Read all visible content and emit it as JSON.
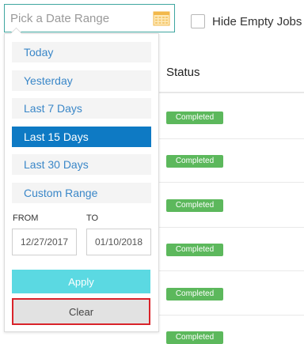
{
  "date_input": {
    "placeholder": "Pick a Date Range",
    "icon": "calendar-icon"
  },
  "hide_empty": {
    "label": "Hide Empty Jobs",
    "checked": false
  },
  "table": {
    "status_header": "Status",
    "rows": [
      {
        "status": "Completed"
      },
      {
        "status": "Completed"
      },
      {
        "status": "Completed"
      },
      {
        "status": "Completed"
      },
      {
        "status": "Completed"
      },
      {
        "status": "Completed"
      }
    ]
  },
  "ranges": [
    {
      "label": "Today",
      "active": false
    },
    {
      "label": "Yesterday",
      "active": false
    },
    {
      "label": "Last 7 Days",
      "active": false
    },
    {
      "label": "Last 15 Days",
      "active": true
    },
    {
      "label": "Last 30 Days",
      "active": false
    },
    {
      "label": "Custom Range",
      "active": false
    }
  ],
  "from": {
    "label": "FROM",
    "value": "12/27/2017"
  },
  "to": {
    "label": "TO",
    "value": "01/10/2018"
  },
  "apply_label": "Apply",
  "clear_label": "Clear",
  "colors": {
    "accent": "#0e7ac4",
    "link": "#3a87c8",
    "apply": "#5bd9e2",
    "badge": "#5cb85c",
    "highlight": "#d9232a"
  }
}
